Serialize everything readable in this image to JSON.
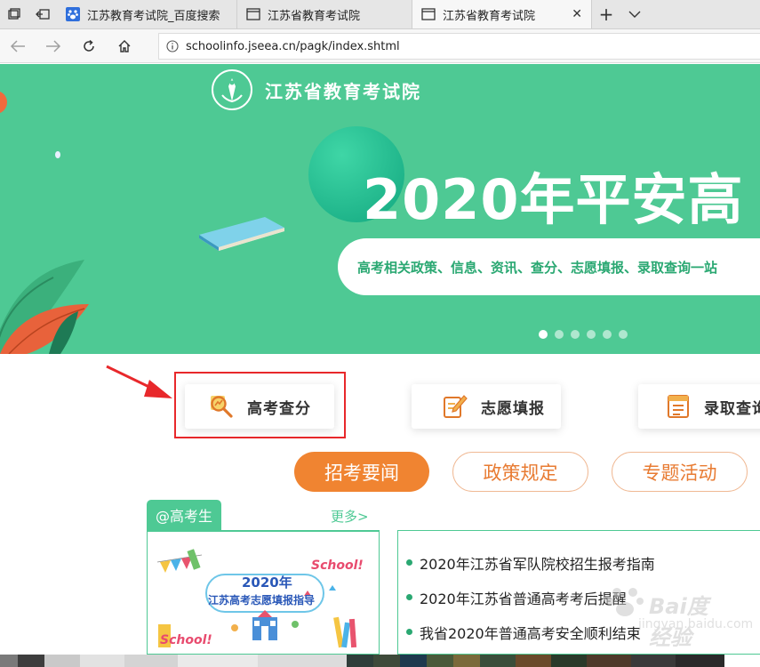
{
  "browser": {
    "tabs": [
      {
        "label": "江苏教育考试院_百度搜索"
      },
      {
        "label": "江苏省教育考试院"
      },
      {
        "label": "江苏省教育考试院",
        "active": true
      }
    ],
    "address": "schoolinfo.jseea.cn/pagk/index.shtml"
  },
  "banner": {
    "site_name": "江苏省教育考试院",
    "headline": "2020年平安高",
    "subline": "高考相关政策、信息、资讯、查分、志愿填报、录取查询一站",
    "active_slide": 1,
    "slide_count": 6
  },
  "quick_links": [
    {
      "label": "高考查分",
      "icon": "magnifier-chart-icon",
      "highlighted": true
    },
    {
      "label": "志愿填报",
      "icon": "pencil-form-icon"
    },
    {
      "label": "录取查询",
      "icon": "list-document-icon"
    }
  ],
  "categories": [
    {
      "label": "招考要闻",
      "active": true
    },
    {
      "label": "政策规定"
    },
    {
      "label": "专题活动"
    }
  ],
  "gaokao_section": {
    "tab_label": "@高考生",
    "more_label": "更多>",
    "poster": {
      "year": "2020年",
      "title": "江苏高考志愿填报指导",
      "school_text": "School!"
    }
  },
  "news": [
    "2020年江苏省军队院校招生报考指南",
    "2020年江苏省普通高考考后提醒",
    "我省2020年普通高考安全顺利结束"
  ],
  "watermark": {
    "line1": "Bai度 经验",
    "line2": "jingyan.baidu.com"
  },
  "colors": {
    "banner_green": "#4ec994",
    "accent_orange": "#f08431",
    "annotation_red": "#e8282b"
  }
}
